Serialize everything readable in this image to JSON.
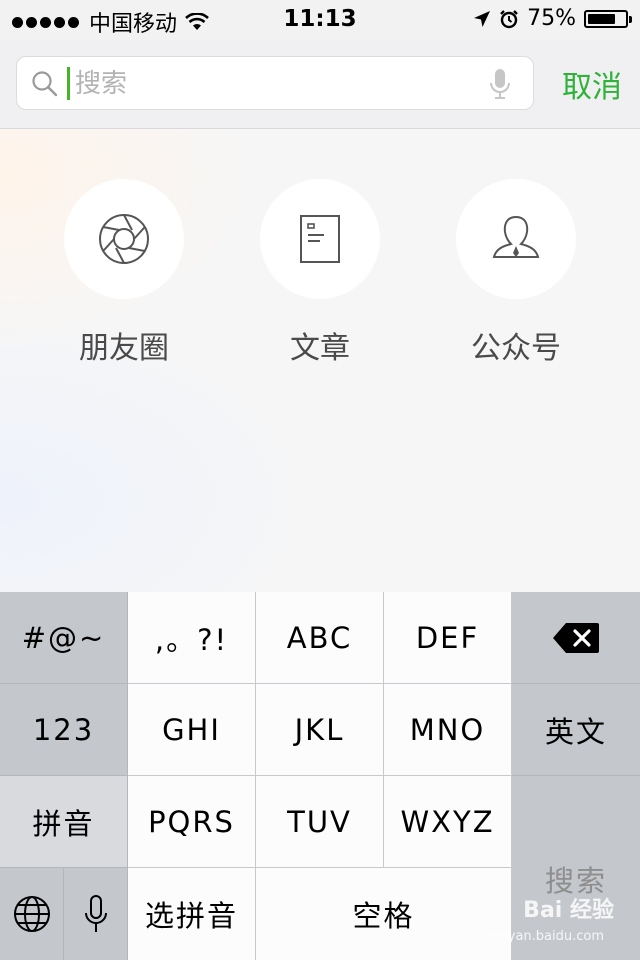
{
  "status_bar": {
    "carrier": "中国移动",
    "time": "11:13",
    "battery_percent": "75%",
    "battery_level": 0.75
  },
  "search": {
    "placeholder": "搜索",
    "cancel_label": "取消"
  },
  "categories": [
    {
      "label": "朋友圈",
      "icon": "aperture-icon"
    },
    {
      "label": "文章",
      "icon": "document-icon"
    },
    {
      "label": "公众号",
      "icon": "person-icon"
    }
  ],
  "keyboard": {
    "symbols": "#@~",
    "punct": ",。?!",
    "abc": "ABC",
    "def": "DEF",
    "num": "123",
    "ghi": "GHI",
    "jkl": "JKL",
    "mno": "MNO",
    "english": "英文",
    "pinyin": "拼音",
    "pqrs": "PQRS",
    "tuv": "TUV",
    "wxyz": "WXYZ",
    "search": "搜索",
    "select_pinyin": "选拼音",
    "space": "空格"
  },
  "watermark": {
    "brand": "Bai 经验",
    "url": "jingyan.baidu.com"
  },
  "colors": {
    "accent_green": "#2fb23a",
    "caret_green": "#46b32b"
  }
}
